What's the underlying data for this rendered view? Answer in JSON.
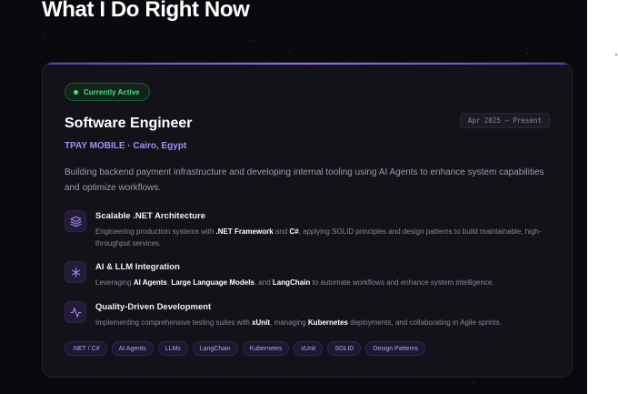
{
  "section": {
    "heading": "What I Do Right Now"
  },
  "job": {
    "status": "Currently Active",
    "date_range": "Apr 2025 — Present",
    "title": "Software Engineer",
    "company": "TPAY MOBILE · Cairo, Egypt",
    "summary": "Building backend payment infrastructure and developing internal tooling using AI Agents to enhance system capabilities and optimize workflows."
  },
  "features": [
    {
      "icon": "layers-icon",
      "title": "Scalable .NET Architecture",
      "desc": [
        {
          "t": "Engineering production systems with "
        },
        {
          "t": ".NET Framework",
          "b": true
        },
        {
          "t": " and "
        },
        {
          "t": "C#",
          "b": true
        },
        {
          "t": ", applying SOLID principles and design patterns to build maintainable, high-throughput services."
        }
      ]
    },
    {
      "icon": "sparkle-icon",
      "title": "AI & LLM Integration",
      "desc": [
        {
          "t": "Leveraging "
        },
        {
          "t": "AI Agents",
          "b": true
        },
        {
          "t": ", "
        },
        {
          "t": "Large Language Models",
          "b": true
        },
        {
          "t": ", and "
        },
        {
          "t": "LangChain",
          "b": true
        },
        {
          "t": " to automate workflows and enhance system intelligence."
        }
      ]
    },
    {
      "icon": "activity-icon",
      "title": "Quality-Driven Development",
      "desc": [
        {
          "t": "Implementing comprehensive testing suites with "
        },
        {
          "t": "xUnit",
          "b": true
        },
        {
          "t": ", managing "
        },
        {
          "t": "Kubernetes",
          "b": true
        },
        {
          "t": " deployments, and collaborating in Agile sprints."
        }
      ]
    }
  ],
  "tags": [
    ".NET / C#",
    "AI Agents",
    "LLMs",
    "LangChain",
    "Kubernetes",
    "xUnit",
    "SOLID",
    "Design Patterns"
  ],
  "colors": {
    "accent": "#a98af2",
    "active_green": "#4ade80",
    "card_bg": "#131219",
    "page_bg": "#0a090e"
  }
}
